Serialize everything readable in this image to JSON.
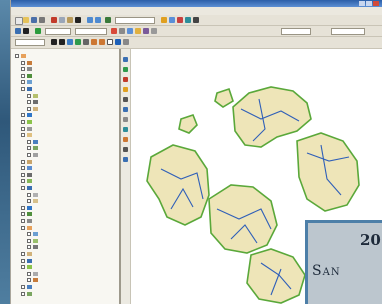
{
  "window": {
    "controls": [
      "minimize",
      "maximize",
      "close"
    ]
  },
  "menu": {
    "items": [
      "",
      "",
      "",
      "",
      "",
      "",
      "",
      ""
    ]
  },
  "toolbar_primary": {
    "scale_value": ""
  },
  "toolbar_editor": {
    "layer_value": "",
    "target_value": ""
  },
  "toolbar_label": {
    "field_value": ""
  },
  "toc": {
    "items": [
      {
        "label": "",
        "swatch": "#e7a15b"
      },
      {
        "label": "",
        "swatch": "#c77b3a"
      },
      {
        "label": "",
        "swatch": "#8a8a8a"
      },
      {
        "label": "",
        "swatch": "#4f8f3c"
      },
      {
        "label": "",
        "swatch": "#6b9fd1"
      },
      {
        "label": "",
        "swatch": "#3a6fb2"
      },
      {
        "label": "",
        "swatch": "#b5c06c"
      },
      {
        "label": "",
        "swatch": "#6d6d6d"
      },
      {
        "label": "",
        "swatch": "#d1b27a"
      },
      {
        "label": "",
        "swatch": "#2f76c8"
      },
      {
        "label": "",
        "swatch": "#8bc34a"
      },
      {
        "label": "",
        "swatch": "#999999"
      },
      {
        "label": "",
        "swatch": "#e0c080"
      },
      {
        "label": "",
        "swatch": "#4a7fbf"
      },
      {
        "label": "",
        "swatch": "#7aa560"
      },
      {
        "label": "",
        "swatch": "#a0a0a0"
      },
      {
        "label": "",
        "swatch": "#c9a46b"
      },
      {
        "label": "",
        "swatch": "#5b8dd0"
      },
      {
        "label": "",
        "swatch": "#6b6b6b"
      },
      {
        "label": "",
        "swatch": "#86b85a"
      },
      {
        "label": "",
        "swatch": "#3a6fb2"
      },
      {
        "label": "",
        "swatch": "#b0b0b0"
      },
      {
        "label": "",
        "swatch": "#d7c08a"
      },
      {
        "label": "",
        "swatch": "#2f76c8"
      },
      {
        "label": "",
        "swatch": "#4f8f3c"
      },
      {
        "label": "",
        "swatch": "#8a8a8a"
      },
      {
        "label": "",
        "swatch": "#e7a15b"
      },
      {
        "label": "",
        "swatch": "#6b9fd1"
      },
      {
        "label": "",
        "swatch": "#9ac06c"
      },
      {
        "label": "",
        "swatch": "#777777"
      },
      {
        "label": "",
        "swatch": "#d1b27a"
      },
      {
        "label": "",
        "swatch": "#3a6fb2"
      },
      {
        "label": "",
        "swatch": "#8bc34a"
      },
      {
        "label": "",
        "swatch": "#aaaaaa"
      },
      {
        "label": "",
        "swatch": "#c77b3a"
      },
      {
        "label": "",
        "swatch": "#4a7fbf"
      },
      {
        "label": "",
        "swatch": "#7aa560"
      }
    ]
  },
  "map": {
    "land_color": "#eee5b8",
    "shore_color": "#5aa83a",
    "road_color": "#2f5fb8",
    "background": "#ffffff"
  },
  "overlay": {
    "line1": "20",
    "line2": "San"
  }
}
